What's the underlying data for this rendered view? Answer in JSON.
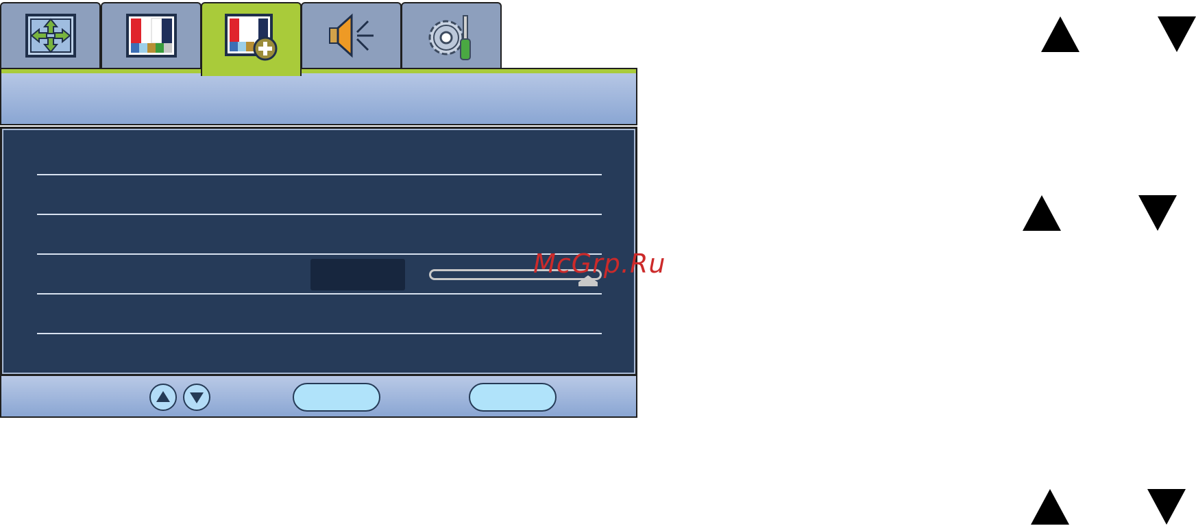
{
  "osd": {
    "tabs": [
      {
        "icon": "display-position-icon",
        "active": false
      },
      {
        "icon": "picture-icon",
        "active": false
      },
      {
        "icon": "picture-advanced-icon",
        "active": true
      },
      {
        "icon": "audio-icon",
        "active": false
      },
      {
        "icon": "system-settings-icon",
        "active": false
      }
    ],
    "slider_level_percent": 100,
    "footer": {
      "buttons": [
        "up-button",
        "down-button"
      ]
    }
  },
  "watermark": "McGrp.Ru",
  "colors": {
    "active_tab": "#a9cb3a",
    "panel": "#263b59",
    "tab": "#8d9fbd",
    "watermark": "#cc2a2a"
  }
}
